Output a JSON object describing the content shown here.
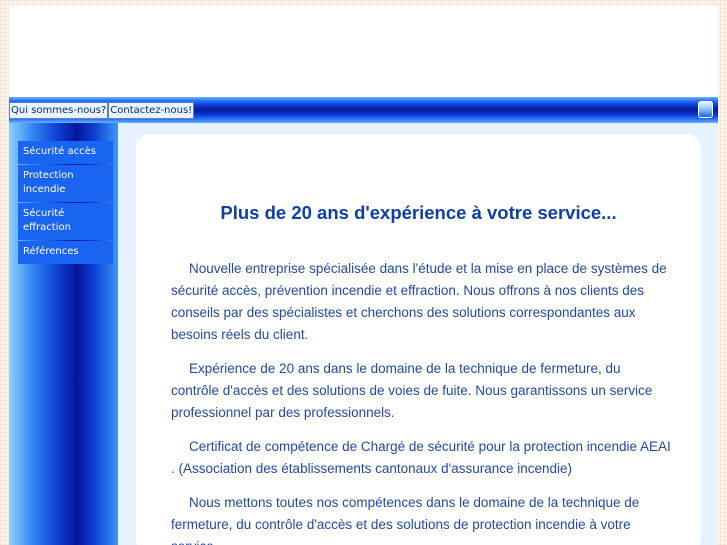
{
  "top_nav": {
    "items": [
      "Qui sommes-nous?",
      "Contactez-nous!"
    ]
  },
  "icons": {
    "language_icon": "globe-icon"
  },
  "sidebar": {
    "items": [
      {
        "label": "Sécurité accès"
      },
      {
        "label": "Protection incendie"
      },
      {
        "label": "Sécurité effraction"
      },
      {
        "label": "Références"
      }
    ]
  },
  "main": {
    "title": "Plus de 20 ans d'expérience à votre service...",
    "paragraphs": [
      "Nouvelle entreprise spécialisée dans l'étude et la mise en place de systèmes de sécurité accès, prévention incendie et effraction. Nous offrons à nos clients des conseils par des spécialistes et cherchons des solutions correspondantes aux besoins réels du client.",
      "Expérience de 20 ans dans le domaine de la technique de fermeture, du contrôle d'accès et des solutions de voies de fuite. Nous garantissons un service professionnel par des professionnels.",
      "Certificat de compétence de Chargé de sécurité pour la protection incendie AEAI . (Association des établissements cantonaux d'assurance incendie)",
      "Nous mettons toutes nos compétences dans le domaine de la technique de fermeture, du contrôle d'accès et des solutions de protection incendie à votre service."
    ]
  },
  "colors": {
    "page_background": "#fdf3ea",
    "nav_dark_blue": "#071a9a",
    "menu_item_blue": "#1a64f2",
    "title_blue": "#0e3fa8",
    "text_blue": "#1f4aa7",
    "content_background": "#e8f1ff"
  }
}
